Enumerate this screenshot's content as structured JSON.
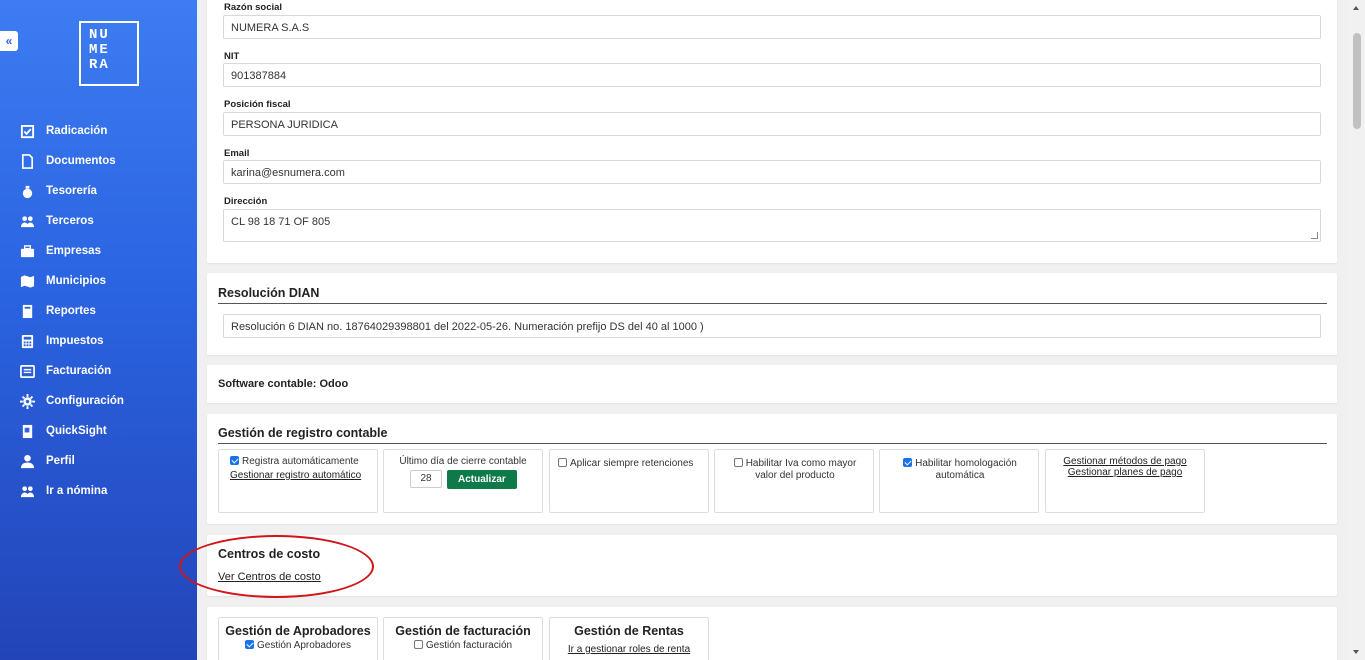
{
  "sidebar": {
    "collapse_label": "«",
    "logo_lines": [
      "NU",
      "ME",
      "RA"
    ],
    "items": [
      {
        "label": "Radicación",
        "icon": "check-square-icon"
      },
      {
        "label": "Documentos",
        "icon": "document-icon"
      },
      {
        "label": "Tesorería",
        "icon": "money-bag-icon"
      },
      {
        "label": "Terceros",
        "icon": "users-icon"
      },
      {
        "label": "Empresas",
        "icon": "briefcase-icon"
      },
      {
        "label": "Municipios",
        "icon": "map-icon"
      },
      {
        "label": "Reportes",
        "icon": "book-icon"
      },
      {
        "label": "Impuestos",
        "icon": "calculator-icon"
      },
      {
        "label": "Facturación",
        "icon": "invoice-icon"
      },
      {
        "label": "Configuración",
        "icon": "gear-icon"
      },
      {
        "label": "QuickSight",
        "icon": "chart-book-icon"
      },
      {
        "label": "Perfil",
        "icon": "user-icon"
      },
      {
        "label": "Ir a nómina",
        "icon": "people-icon"
      }
    ]
  },
  "company": {
    "razon_label": "Razón social",
    "razon_value": "NUMERA S.A.S",
    "nit_label": "NIT",
    "nit_value": "901387884",
    "posicion_label": "Posición fiscal",
    "posicion_value": "PERSONA JURIDICA",
    "email_label": "Email",
    "email_value": "karina@esnumera.com",
    "direccion_label": "Dirección",
    "direccion_value": "CL 98 18 71 OF 805"
  },
  "resolucion": {
    "title": "Resolución DIAN",
    "value": "Resolución 6 DIAN no. 18764029398801 del 2022-05-26. Numeración prefijo DS del 40 al 1000 )"
  },
  "software": {
    "label": "Software contable: Odoo"
  },
  "registro": {
    "title": "Gestión de registro contable",
    "auto_label": "Registra automáticamente",
    "auto_checked": true,
    "auto_link": "Gestionar registro automático",
    "cierre_label": "Último día de cierre contable",
    "cierre_value": "28",
    "actualizar_label": "Actualizar",
    "retenciones_label": "Aplicar siempre retenciones",
    "iva_label": "Habilitar Iva como mayor valor del producto",
    "homologacion_label": "Habilitar homologación automática",
    "homologacion_checked": true,
    "metodos_link": "Gestionar métodos de pago",
    "planes_link": "Gestionar planes de pago"
  },
  "centros": {
    "title": "Centros de costo",
    "link": "Ver Centros de costo"
  },
  "bottom": {
    "aprobadores_title": "Gestión de Aprobadores",
    "aprobadores_cb": "Gestión Aprobadores",
    "facturacion_title": "Gestión de facturación",
    "facturacion_cb": "Gestión facturación",
    "rentas_title": "Gestión de Rentas",
    "rentas_link": "Ir a gestionar roles de renta"
  },
  "colors": {
    "sidebar_top": "#3d7cf2",
    "sidebar_bottom": "#2344b8",
    "accent_green": "#0e7a4a",
    "annotation_red": "#d1161a"
  }
}
